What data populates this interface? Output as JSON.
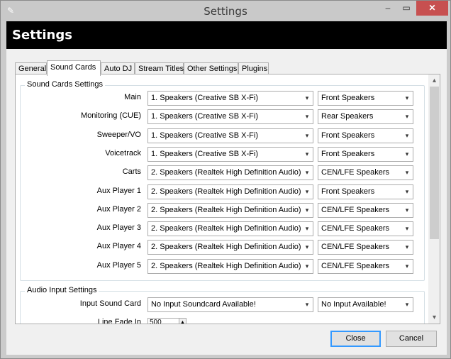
{
  "window": {
    "title": "Settings",
    "header": "Settings"
  },
  "tabs": [
    "General",
    "Sound Cards",
    "Auto DJ",
    "Stream Titles",
    "Other Settings",
    "Plugins"
  ],
  "sound_cards": {
    "group_label": "Sound Cards Settings",
    "rows": [
      {
        "label": "Main",
        "device": "1. Speakers (Creative SB X-Fi)",
        "channel": "Front Speakers"
      },
      {
        "label": "Monitoring (CUE)",
        "device": "1. Speakers (Creative SB X-Fi)",
        "channel": "Rear Speakers"
      },
      {
        "label": "Sweeper/VO",
        "device": "1. Speakers (Creative SB X-Fi)",
        "channel": "Front Speakers"
      },
      {
        "label": "Voicetrack",
        "device": "1. Speakers (Creative SB X-Fi)",
        "channel": "Front Speakers"
      },
      {
        "label": "Carts",
        "device": "2. Speakers (Realtek High Definition Audio)",
        "channel": "CEN/LFE Speakers"
      },
      {
        "label": "Aux Player 1",
        "device": "2. Speakers (Realtek High Definition Audio)",
        "channel": "Front Speakers"
      },
      {
        "label": "Aux Player 2",
        "device": "2. Speakers (Realtek High Definition Audio)",
        "channel": "CEN/LFE Speakers"
      },
      {
        "label": "Aux Player 3",
        "device": "2. Speakers (Realtek High Definition Audio)",
        "channel": "CEN/LFE Speakers"
      },
      {
        "label": "Aux Player 4",
        "device": "2. Speakers (Realtek High Definition Audio)",
        "channel": "CEN/LFE Speakers"
      },
      {
        "label": "Aux Player 5",
        "device": "2. Speakers (Realtek High Definition Audio)",
        "channel": "CEN/LFE Speakers"
      }
    ]
  },
  "audio_input": {
    "group_label": "Audio Input Settings",
    "input_label": "Input Sound Card",
    "input_device": "No Input Soundcard Available!",
    "input_channel": "No Input Available!",
    "fade_label": "Line Fade In",
    "fade_value": "500"
  },
  "buttons": {
    "close": "Close",
    "cancel": "Cancel"
  },
  "icons": {
    "dropdown": "▾",
    "scroll_up": "▴",
    "scroll_down": "▾",
    "spin_up": "▲"
  }
}
